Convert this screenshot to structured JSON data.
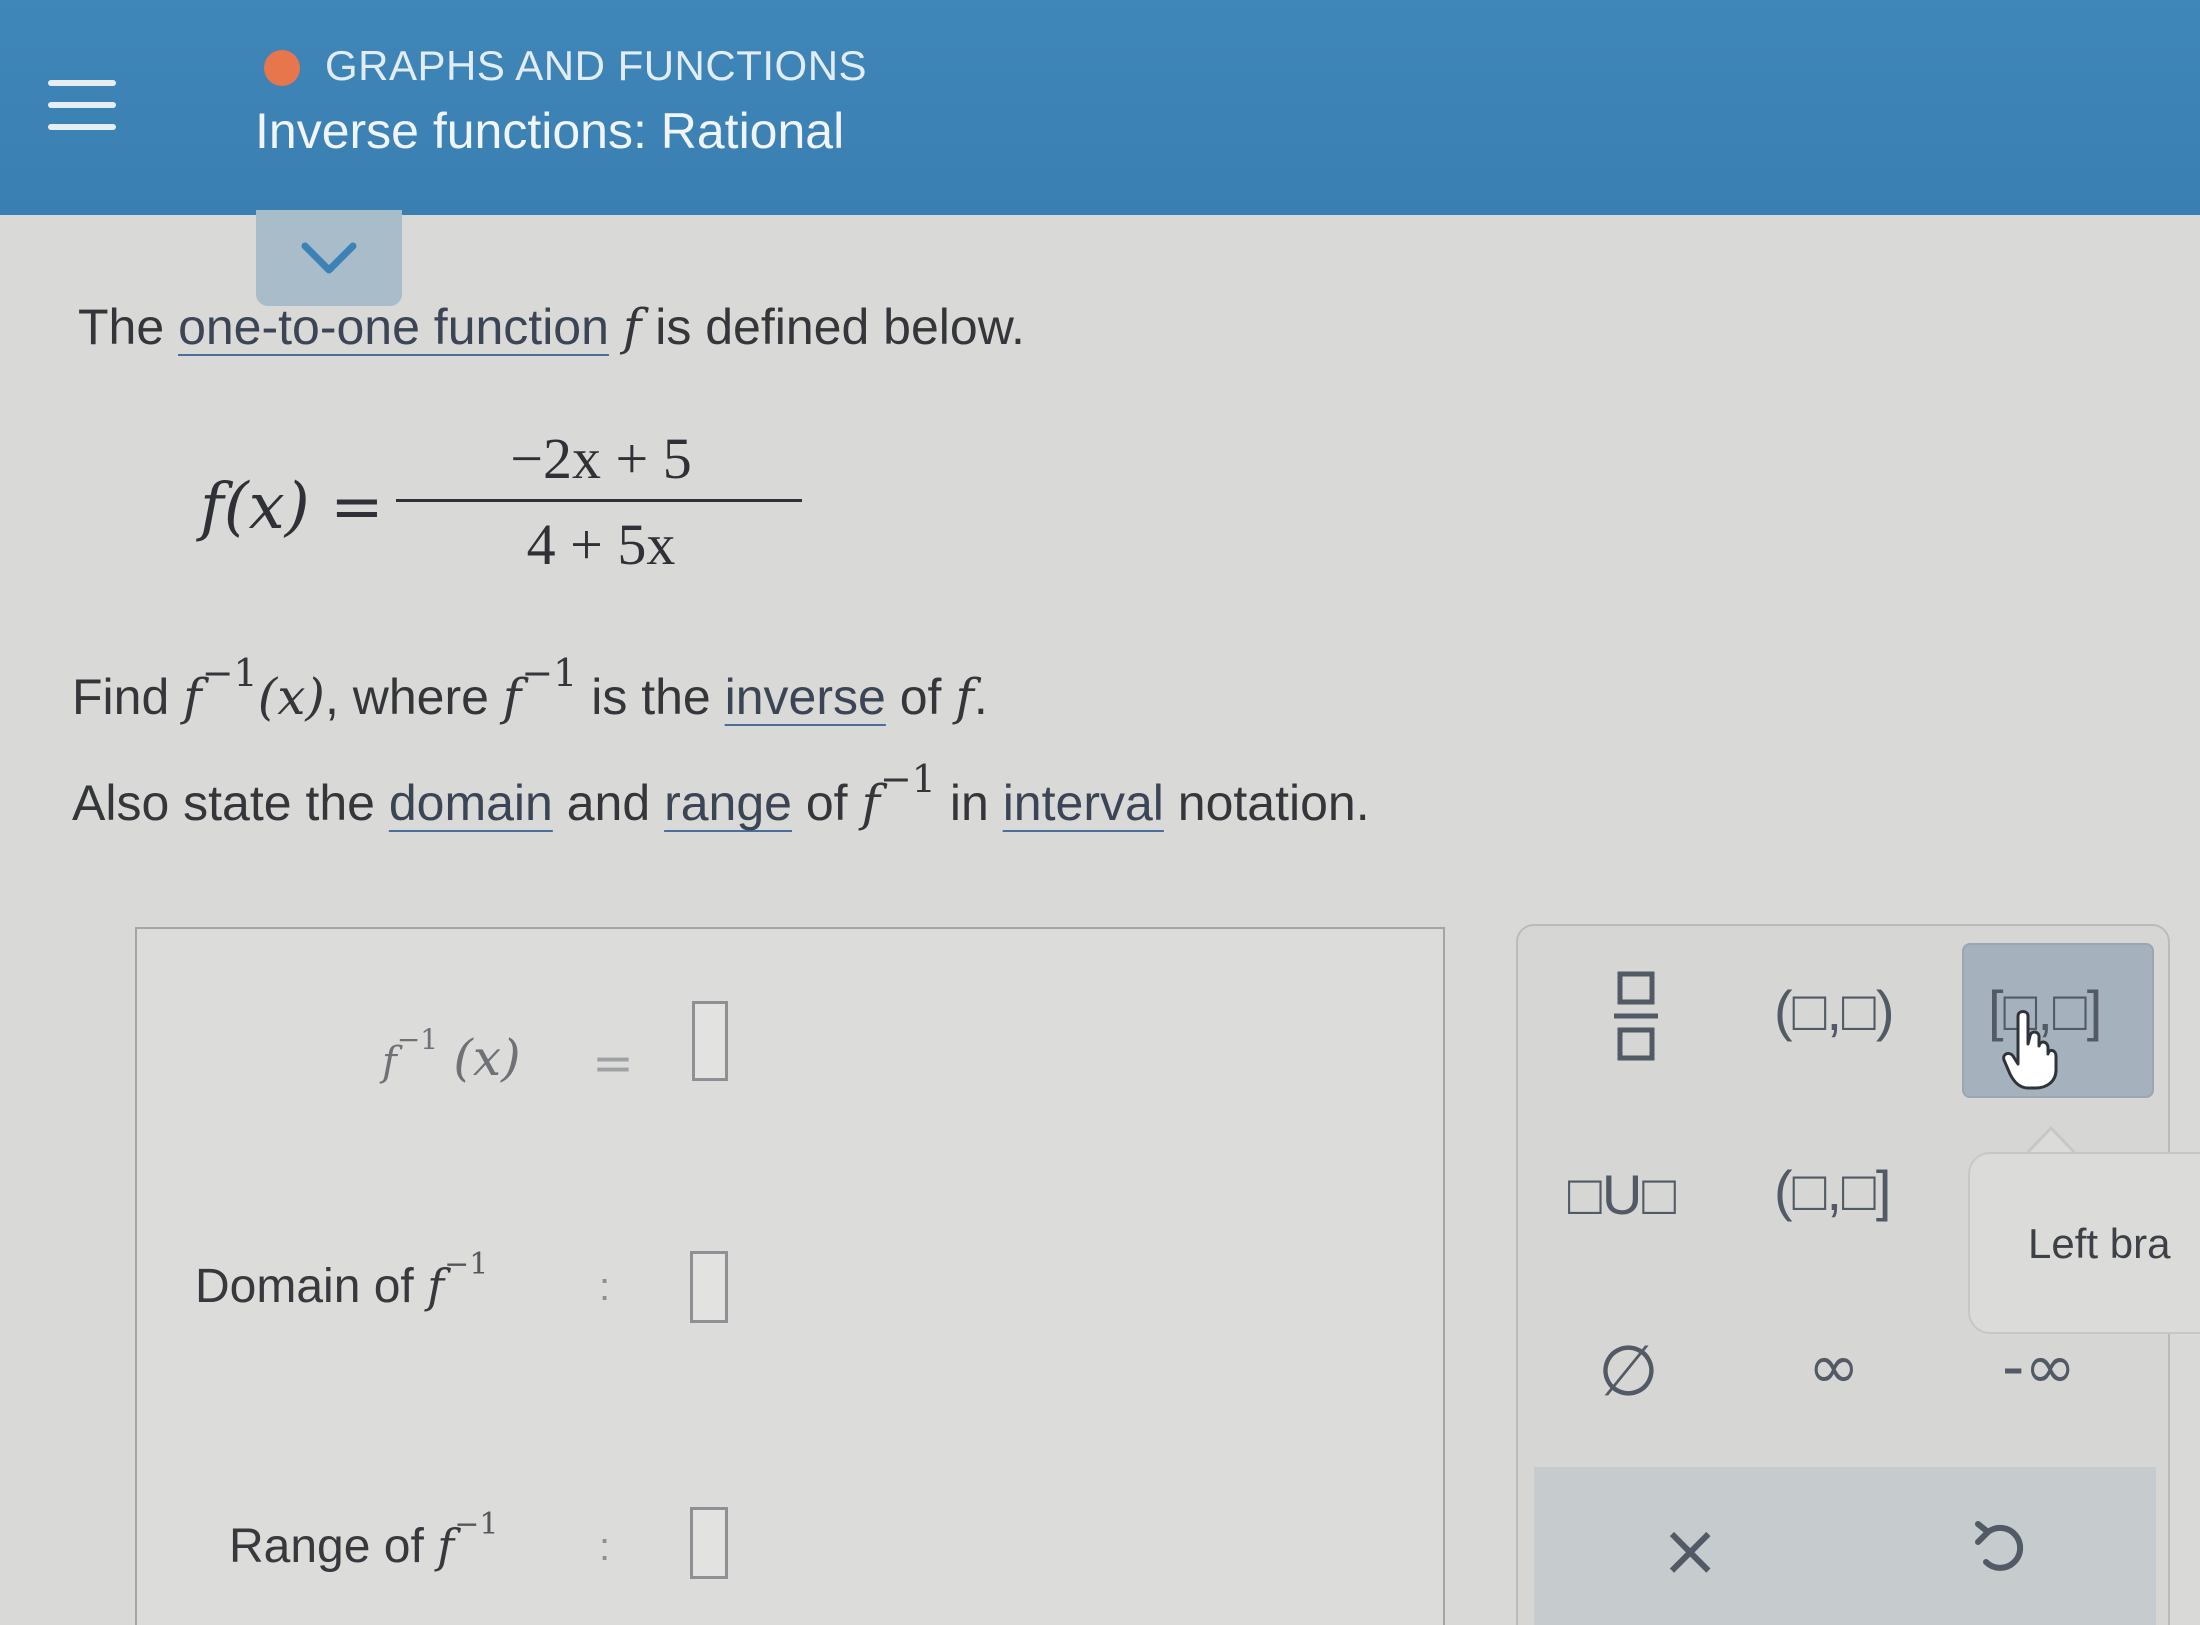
{
  "header": {
    "topic": "GRAPHS AND FUNCTIONS",
    "title": "Inverse functions: Rational",
    "menu_icon": "hamburger-menu-icon",
    "collapse_icon": "chevron-down-icon",
    "topic_dot_color": "#e8764c"
  },
  "problem": {
    "line1": {
      "lead": "The ",
      "link": "one-to-one function",
      "var": "f",
      "trail": " is defined below."
    },
    "formula": {
      "lhs": "f(x) =",
      "numerator": "−2x + 5",
      "denominator": "4 + 5x"
    },
    "line2": {
      "lead": "Find ",
      "f": "f",
      "sup": "−1",
      "arg": "(x)",
      "mid": ", where ",
      "f2": "f",
      "sup2": "−1",
      "mid2": " is the ",
      "link": "inverse",
      "of": " of ",
      "f3": "f",
      "end": "."
    },
    "line3": {
      "lead": "Also state the ",
      "link1": "domain",
      "and": " and ",
      "link2": "range",
      "of": " of ",
      "f": "f",
      "sup": "−1",
      "in": " in ",
      "link3": "interval",
      "end": " notation."
    }
  },
  "answers": {
    "inverse": {
      "f": "f",
      "sup": "−1",
      "arg": "(x)",
      "eq": "="
    },
    "domain": {
      "label": "Domain of ",
      "f": "f",
      "sup": "−1",
      "colon": ":"
    },
    "range": {
      "label": "Range of ",
      "f": "f",
      "sup": "−1",
      "colon": ":"
    }
  },
  "keypad": {
    "open_open": "(□,□)",
    "closed_closed": "[□,□]",
    "union": "□U□",
    "open_closed": "(□,□]",
    "empty_set": "∅",
    "infinity": "∞",
    "neg_infinity": "-∞",
    "tooltip": "Left bra",
    "clear": "×",
    "undo_icon": "undo-icon",
    "fraction_icon": "fraction-icon",
    "cursor_icon": "hand-pointer-icon"
  }
}
